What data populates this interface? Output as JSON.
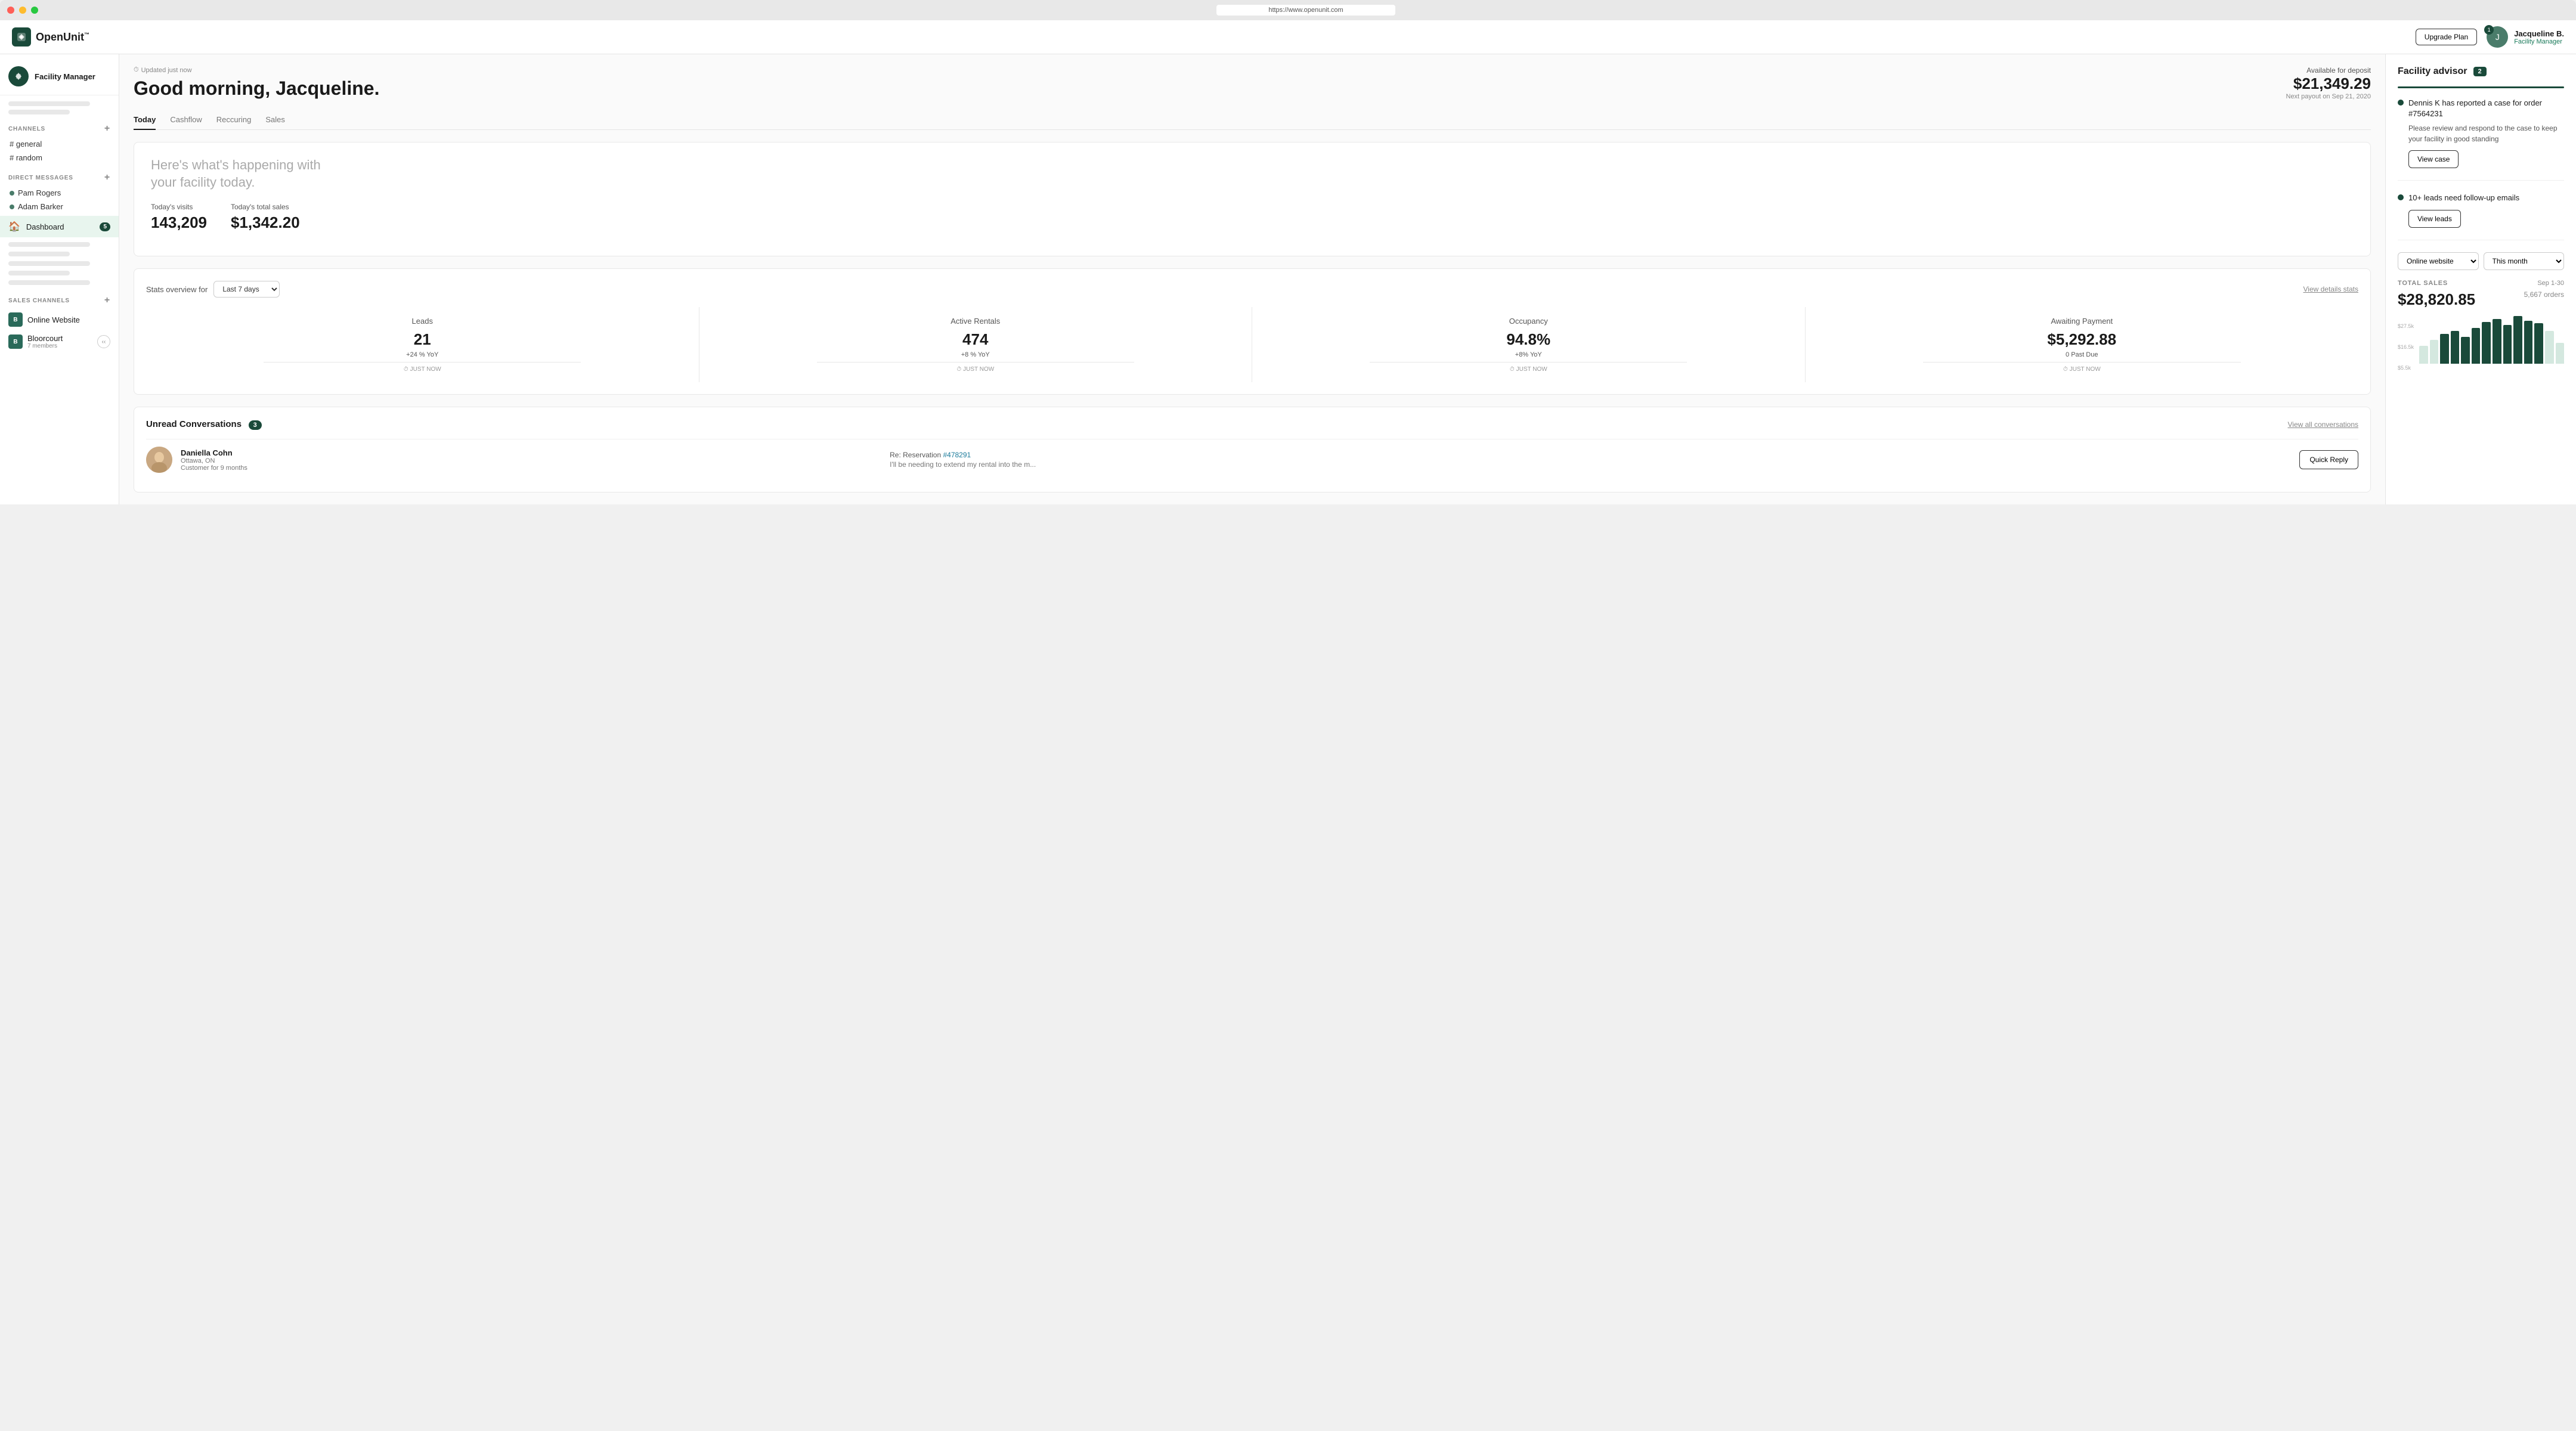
{
  "browser": {
    "url": "https://www.openunit.com",
    "traffic_lights": [
      "red",
      "yellow",
      "green"
    ]
  },
  "navbar": {
    "brand_name": "OpenUnit",
    "brand_tm": "™",
    "upgrade_label": "Upgrade Plan",
    "user_badge": "1",
    "user_name": "Jacqueline B.",
    "user_role": "Facility Manager"
  },
  "sidebar": {
    "user_name": "Facility Manager",
    "channels_label": "CHANNELS",
    "channels": [
      {
        "name": "# general"
      },
      {
        "name": "# random"
      }
    ],
    "direct_messages_label": "DIRECT MESSAGES",
    "direct_messages": [
      {
        "name": "Pam Rogers"
      },
      {
        "name": "Adam Barker"
      }
    ],
    "nav_items": [
      {
        "label": "Dashboard",
        "icon": "🏠",
        "active": true,
        "badge": "5"
      }
    ],
    "sales_channels_label": "SALES CHANNELS",
    "sales_channels": [
      {
        "name": "Online Website",
        "icon": "B",
        "badge": ""
      },
      {
        "name": "Bloorcourt",
        "sub": "7 members",
        "icon": "B",
        "badge": ""
      }
    ]
  },
  "main": {
    "updated_label": "Updated just now",
    "greeting": "Good morning, Jacqueline.",
    "deposit_label": "Available for deposit",
    "deposit_amount": "$21,349.29",
    "deposit_next": "Next payout on Sep 21, 2020",
    "tabs": [
      {
        "label": "Today",
        "active": true
      },
      {
        "label": "Cashflow",
        "active": false
      },
      {
        "label": "Reccuring",
        "active": false
      },
      {
        "label": "Sales",
        "active": false
      }
    ],
    "today_visits_label": "Today's visits",
    "today_visits_value": "143,209",
    "today_sales_label": "Today's total sales",
    "today_sales_value": "$1,342.20",
    "stats": {
      "title": "Stats overview for",
      "period": "Last 7 days",
      "view_details": "View details stats",
      "cells": [
        {
          "label": "Leads",
          "value": "21",
          "change": "+24 % YoY",
          "time": "JUST NOW"
        },
        {
          "label": "Active Rentals",
          "value": "474",
          "change": "+8 % YoY",
          "time": "JUST NOW"
        },
        {
          "label": "Occupancy",
          "value": "94.8%",
          "change": "+8% YoY",
          "time": "JUST NOW"
        },
        {
          "label": "Awaiting Payment",
          "value": "$5,292.88",
          "change": "0 Past Due",
          "time": "JUST NOW"
        }
      ]
    },
    "conversations": {
      "title": "Unread Conversations",
      "badge": "3",
      "view_all": "View all conversations",
      "items": [
        {
          "name": "Daniella Cohn",
          "location": "Ottawa, ON",
          "customer_since": "Customer for 9 months",
          "subject_text": "Re: Reservation ",
          "subject_link": "#478291",
          "preview": "I'll be needing to extend my rental into the m...",
          "quick_reply": "Quick Reply"
        }
      ]
    }
  },
  "right_panel": {
    "advisor_title": "Facility advisor",
    "advisor_badge": "2",
    "advisor_items": [
      {
        "text": "Dennis K has reported a case for order #7564231",
        "subtext": "Please review and respond to the case to keep your facility in good standing",
        "action": "View case"
      },
      {
        "text": "10+ leads need follow-up emails",
        "subtext": "",
        "action": "View leads"
      }
    ],
    "filter_channel": "Online website",
    "filter_period": "This month",
    "total_sales_label": "TOTAL SALES",
    "total_sales_date": "Sep 1-30",
    "total_sales_amount": "$28,820.85",
    "total_orders": "5,667 orders",
    "chart": {
      "y_labels": [
        "$27.5k",
        "$16.5k",
        "$5.5k"
      ],
      "bars": [
        {
          "height": 30,
          "light": true
        },
        {
          "height": 40,
          "light": true
        },
        {
          "height": 50,
          "light": false
        },
        {
          "height": 55,
          "light": false
        },
        {
          "height": 45,
          "light": false
        },
        {
          "height": 60,
          "light": false
        },
        {
          "height": 70,
          "light": false
        },
        {
          "height": 75,
          "light": false
        },
        {
          "height": 65,
          "light": false
        },
        {
          "height": 80,
          "light": false
        },
        {
          "height": 72,
          "light": false
        },
        {
          "height": 68,
          "light": false
        },
        {
          "height": 55,
          "light": true
        },
        {
          "height": 35,
          "light": true
        }
      ]
    }
  }
}
